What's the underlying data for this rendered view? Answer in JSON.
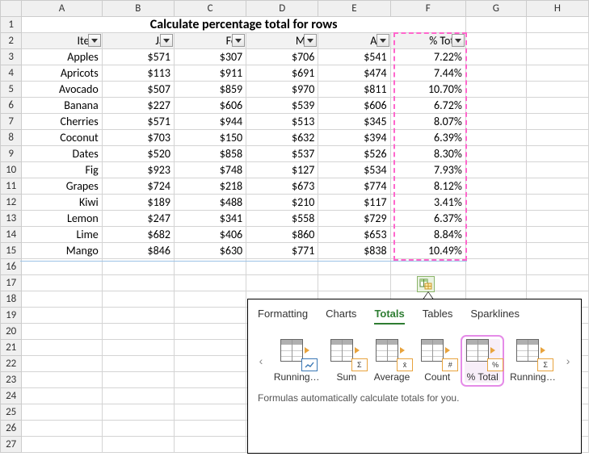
{
  "title": "Calculate percentage total for rows",
  "columns": [
    "A",
    "B",
    "C",
    "D",
    "E",
    "F",
    "G",
    "H"
  ],
  "headers": {
    "item": "Item",
    "jan": "Jan",
    "feb": "Feb",
    "mar": "Mar",
    "apr": "Apr",
    "pct": "% Total"
  },
  "rows": [
    {
      "n": "3",
      "item": "Apples",
      "jan": "$571",
      "feb": "$307",
      "mar": "$706",
      "apr": "$541",
      "pct": "7.22%"
    },
    {
      "n": "4",
      "item": "Apricots",
      "jan": "$113",
      "feb": "$911",
      "mar": "$691",
      "apr": "$474",
      "pct": "7.44%"
    },
    {
      "n": "5",
      "item": "Avocado",
      "jan": "$507",
      "feb": "$859",
      "mar": "$970",
      "apr": "$811",
      "pct": "10.70%"
    },
    {
      "n": "6",
      "item": "Banana",
      "jan": "$227",
      "feb": "$606",
      "mar": "$539",
      "apr": "$606",
      "pct": "6.72%"
    },
    {
      "n": "7",
      "item": "Cherries",
      "jan": "$571",
      "feb": "$944",
      "mar": "$513",
      "apr": "$345",
      "pct": "8.07%"
    },
    {
      "n": "8",
      "item": "Coconut",
      "jan": "$703",
      "feb": "$150",
      "mar": "$632",
      "apr": "$394",
      "pct": "6.39%"
    },
    {
      "n": "9",
      "item": "Dates",
      "jan": "$520",
      "feb": "$858",
      "mar": "$537",
      "apr": "$526",
      "pct": "8.30%"
    },
    {
      "n": "10",
      "item": "Fig",
      "jan": "$923",
      "feb": "$748",
      "mar": "$127",
      "apr": "$534",
      "pct": "7.93%"
    },
    {
      "n": "11",
      "item": "Grapes",
      "jan": "$724",
      "feb": "$218",
      "mar": "$673",
      "apr": "$774",
      "pct": "8.12%"
    },
    {
      "n": "12",
      "item": "Kiwi",
      "jan": "$189",
      "feb": "$488",
      "mar": "$210",
      "apr": "$117",
      "pct": "3.41%"
    },
    {
      "n": "13",
      "item": "Lemon",
      "jan": "$247",
      "feb": "$341",
      "mar": "$558",
      "apr": "$729",
      "pct": "6.37%"
    },
    {
      "n": "14",
      "item": "Lime",
      "jan": "$682",
      "feb": "$406",
      "mar": "$860",
      "apr": "$653",
      "pct": "8.84%"
    },
    {
      "n": "15",
      "item": "Mango",
      "jan": "$846",
      "feb": "$630",
      "mar": "$771",
      "apr": "$838",
      "pct": "10.49%"
    }
  ],
  "empty_rows": [
    "16",
    "17",
    "18",
    "19",
    "20",
    "21",
    "22",
    "23",
    "24",
    "25",
    "26",
    "27"
  ],
  "popup": {
    "tabs": {
      "formatting": "Formatting",
      "charts": "Charts",
      "totals": "Totals",
      "tables": "Tables",
      "sparklines": "Sparklines"
    },
    "items": {
      "running1": "Running…",
      "sum": "Sum",
      "average": "Average",
      "count": "Count",
      "pct_total": "% Total",
      "running2": "Running…"
    },
    "badges": {
      "sum": "Σ",
      "avg": "x̄",
      "count": "#",
      "pct": "%",
      "run": "Σ"
    },
    "footer": "Formulas automatically calculate totals for you."
  }
}
